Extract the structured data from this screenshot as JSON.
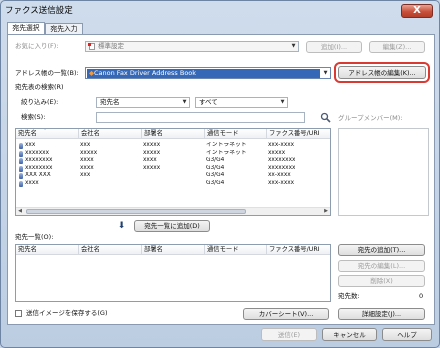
{
  "window": {
    "title": "ファクス送信設定",
    "close_glyph": "X"
  },
  "tabs": [
    "宛先選択",
    "宛先入力"
  ],
  "favorites": {
    "label": "お気に入り(F):",
    "value": "標準設定",
    "add_btn": "追加(I)...",
    "edit_btn": "編集(Z)..."
  },
  "addressbook": {
    "label": "アドレス帳の一覧(B):",
    "value": "Canon Fax Driver Address Book",
    "edit_btn": "アドレス帳の編集(K)..."
  },
  "search": {
    "group_label": "宛先表の検索(R)",
    "filter_label": "絞り込み(E):",
    "filter_field": "宛先名",
    "filter_value": "すべて",
    "keyword_label": "検索(S):",
    "keyword_value": "",
    "group_members_label": "グループメンバー(M):"
  },
  "dest_table": {
    "columns": [
      "宛先名",
      "会社名",
      "部署名",
      "通信モード",
      "ファクス番号/URI"
    ],
    "rows": [
      [
        "xxx",
        "xxx",
        "xxxxx",
        "イントラネット",
        "xxx-xxxx"
      ],
      [
        "xxxxxxx",
        "xxxxx",
        "xxxxx",
        "イントラネット",
        "xxxxx"
      ],
      [
        "xxxxxxxx",
        "xxxx",
        "xxxx",
        "G3/G4",
        "xxxxxxxx"
      ],
      [
        "xxxxxxxx",
        "xxxx",
        "xxxxx",
        "G3/G4",
        "xxxxxxxx"
      ],
      [
        "XXX XXX",
        "xxx",
        "",
        "G3/G4",
        "xx-xxxx"
      ],
      [
        "xxxx",
        "",
        "",
        "G3/G4",
        "xxx-xxxx"
      ]
    ]
  },
  "add_to_list_btn": "宛先一覧に追加(D)",
  "dest_list": {
    "label": "宛先一覧(O):",
    "columns": [
      "宛先名",
      "会社名",
      "部署名",
      "通信モード",
      "ファクス番号/URI"
    ],
    "add_btn": "宛先の追加(T)...",
    "edit_btn": "宛先の編集(L)...",
    "delete_btn": "削除(X)",
    "count_label": "宛先数:",
    "count_value": "0"
  },
  "save_image_label": "送信イメージを保存する(G)",
  "cover_btn": "カバーシート(V)...",
  "detail_btn": "詳細設定(J)...",
  "footer": {
    "send": "送信(E)",
    "cancel": "キャンセル",
    "help": "ヘルプ"
  }
}
